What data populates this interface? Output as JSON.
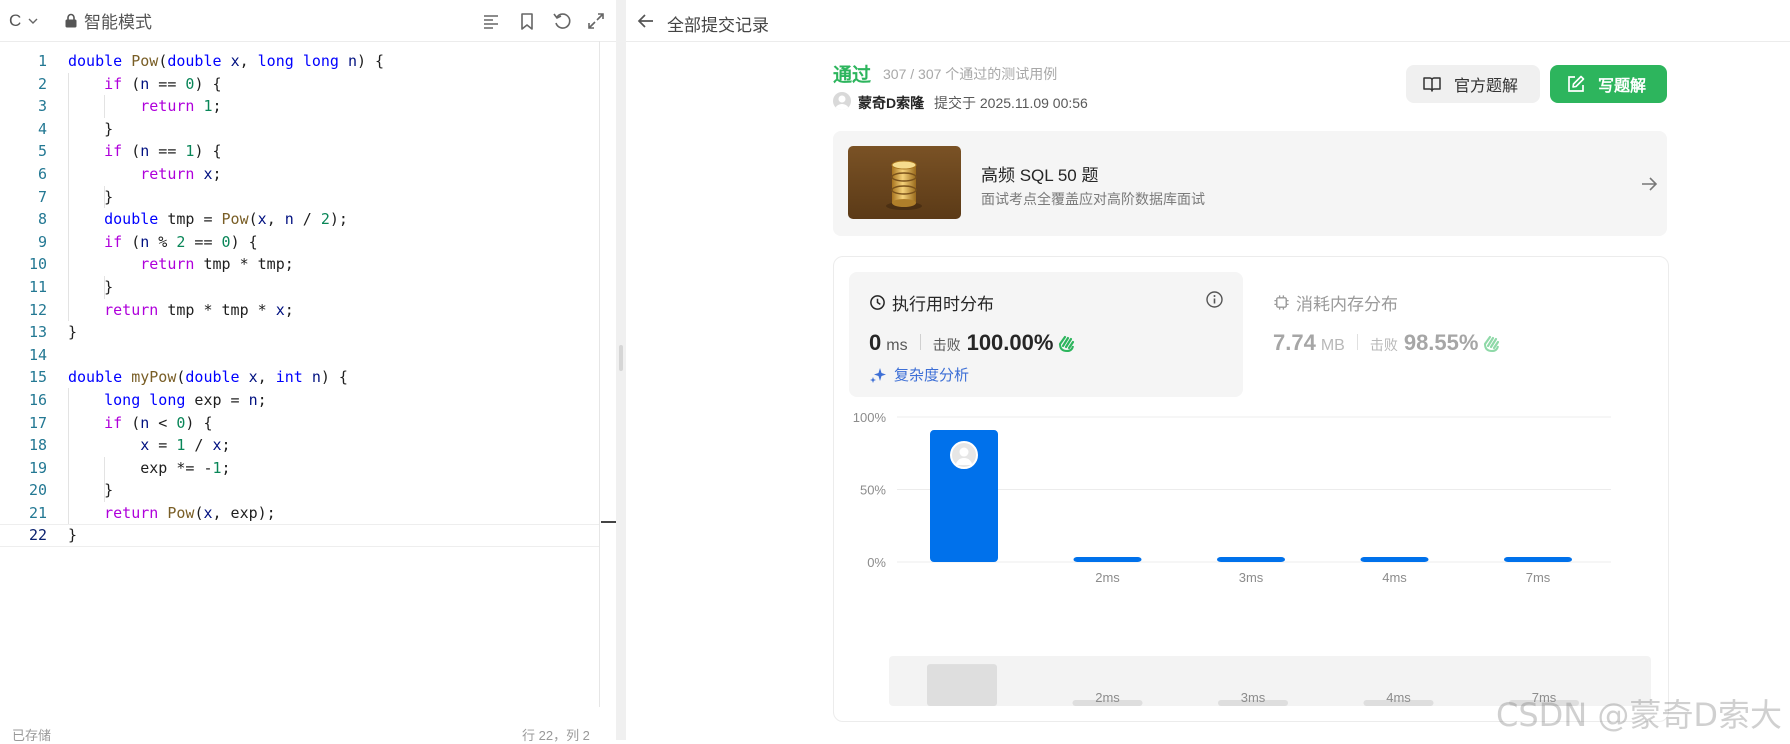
{
  "editor": {
    "language": "C",
    "mode_label": "智能模式",
    "status_left": "已存储",
    "status_right": "行 22，列 2",
    "current_line": 22,
    "lines": [
      {
        "n": "1"
      },
      {
        "n": "2"
      },
      {
        "n": "3"
      },
      {
        "n": "4"
      },
      {
        "n": "5"
      },
      {
        "n": "6"
      },
      {
        "n": "7"
      },
      {
        "n": "8"
      },
      {
        "n": "9"
      },
      {
        "n": "10"
      },
      {
        "n": "11"
      },
      {
        "n": "12"
      },
      {
        "n": "13"
      },
      {
        "n": "14"
      },
      {
        "n": "15"
      },
      {
        "n": "16"
      },
      {
        "n": "17"
      },
      {
        "n": "18"
      },
      {
        "n": "19"
      },
      {
        "n": "20"
      },
      {
        "n": "21"
      },
      {
        "n": "22"
      }
    ],
    "code_text": [
      "double Pow(double x, long long n) {",
      "    if (n == 0) {",
      "        return 1;",
      "    }",
      "    if (n == 1) {",
      "        return x;",
      "    }",
      "    double tmp = Pow(x, n / 2);",
      "    if (n % 2 == 0) {",
      "        return tmp * tmp;",
      "    }",
      "    return tmp * tmp * x;",
      "}",
      "",
      "double myPow(double x, int n) {",
      "    long long exp = n;",
      "    if (n < 0) {",
      "        x = 1 / x;",
      "        exp *= -1;",
      "    }",
      "    return Pow(x, exp);",
      "}"
    ]
  },
  "header": {
    "back_label": "全部提交记录"
  },
  "result": {
    "status": "通过",
    "cases": "307 / 307 个通过的测试用例",
    "username": "蒙奇D索隆",
    "submitted": "提交于 2025.11.09 00:56",
    "btn_official": "官方题解",
    "btn_write": "写题解",
    "accent_green": "#2db55d"
  },
  "promo": {
    "title": "高频 SQL 50 题",
    "desc": "面试考点全覆盖应对高阶数据库面试"
  },
  "runtime": {
    "title": "执行用时分布",
    "value": "0",
    "unit": "ms",
    "beats_label": "击败",
    "beats": "100.00%",
    "complexity": "复杂度分析"
  },
  "memory": {
    "title": "消耗内存分布",
    "value": "7.74",
    "unit": "MB",
    "beats_label": "击败",
    "beats": "98.55%"
  },
  "chart_data": {
    "type": "bar",
    "categories": [
      "0ms",
      "2ms",
      "3ms",
      "4ms",
      "7ms"
    ],
    "category_labels": [
      "",
      "2ms",
      "3ms",
      "4ms",
      "7ms"
    ],
    "values": [
      91,
      2,
      2,
      2,
      2
    ],
    "ylim": [
      0,
      100
    ],
    "yticks": [
      "100%",
      "50%",
      "0%"
    ],
    "ytick_values": [
      100,
      50,
      0
    ],
    "grid": true,
    "bar_color": "#0071eb",
    "highlight_index": 0
  },
  "watermark": "CSDN @蒙奇D索大"
}
